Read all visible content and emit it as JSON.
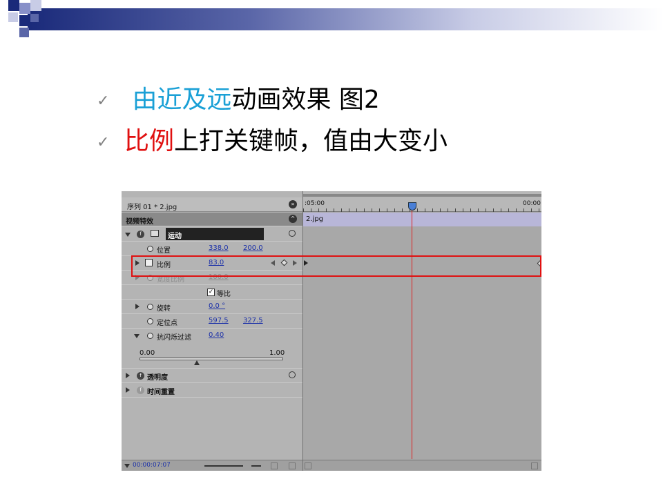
{
  "slide": {
    "bullet1": {
      "highlight": "由近及远",
      "rest": "动画效果 图2",
      "highlight_color": "#1aa0d6"
    },
    "bullet2": {
      "highlight": "比例",
      "rest": "上打关键帧，值由大变小",
      "highlight_color": "#e01010"
    },
    "check_icon": "✓"
  },
  "panel": {
    "sequence_tab": "序列 01 * 2.jpg",
    "section_title": "视频特效",
    "timecode_start": ":05:00",
    "timecode_end": "00:00",
    "clip_name": "2.jpg",
    "motion": {
      "label": "运动",
      "position_label": "位置",
      "position_x": "338.0",
      "position_y": "200.0",
      "scale_label": "比例",
      "scale_value": "83.0",
      "scale_width_label": "宽度比例",
      "scale_width_value": "100.0",
      "uniform_label": "等比",
      "rotation_label": "旋转",
      "rotation_value": "0.0 °",
      "anchor_label": "定位点",
      "anchor_x": "597.5",
      "anchor_y": "327.5",
      "flicker_label": "抗闪烁过滤",
      "flicker_value": "0.40",
      "slider_min": "0.00",
      "slider_max": "1.00"
    },
    "opacity_label": "透明度",
    "time_remap_label": "时间重置",
    "footer_timecode": "00:00:07:07",
    "accent_playhead": "#e02020"
  }
}
